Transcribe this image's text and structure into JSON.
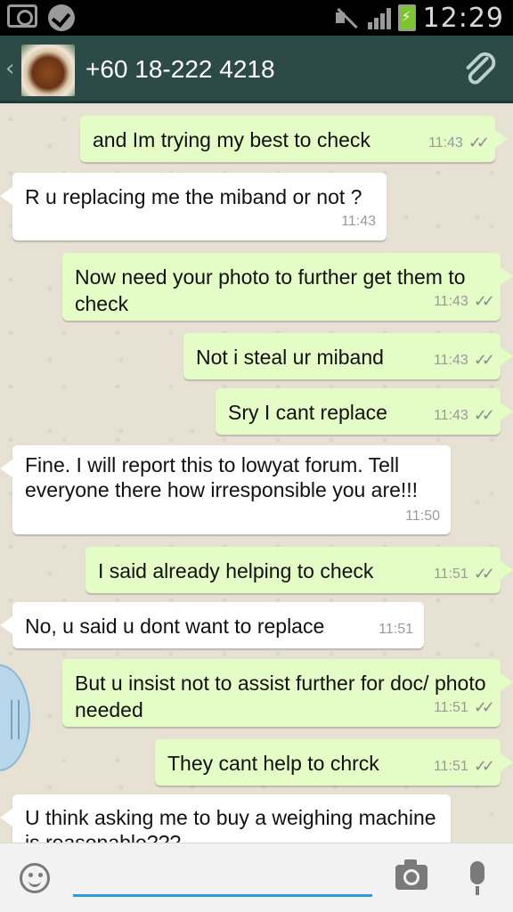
{
  "status_bar": {
    "time": "12:29",
    "icons": [
      "camera-icon",
      "check-badge-icon",
      "mute-icon",
      "signal-icon",
      "battery-charging-icon"
    ]
  },
  "header": {
    "back_icon": "chevron-left-icon",
    "contact_name": "+60 18-222 4218",
    "attach_icon": "paperclip-icon"
  },
  "messages": [
    {
      "direction": "out",
      "text": "and Im trying my best to check",
      "time": "11:43",
      "ticks": "✓✓"
    },
    {
      "direction": "in",
      "text": "R u replacing me the miband or not ?",
      "time": "11:43"
    },
    {
      "direction": "out",
      "text": "Now need your photo to further get them to check",
      "time": "11:43",
      "ticks": "✓✓"
    },
    {
      "direction": "out",
      "text": "Not i steal ur miband",
      "time": "11:43",
      "ticks": "✓✓"
    },
    {
      "direction": "out",
      "text": "Sry I cant replace",
      "time": "11:43",
      "ticks": "✓✓"
    },
    {
      "direction": "in",
      "text": "Fine. I will report this to lowyat forum. Tell everyone there how irresponsible you are!!!",
      "time": "11:50"
    },
    {
      "direction": "out",
      "text": "I said already helping to check",
      "time": "11:51",
      "ticks": "✓✓"
    },
    {
      "direction": "in",
      "text": "No, u said u dont want to replace",
      "time": "11:51"
    },
    {
      "direction": "out",
      "text": "But u insist not to assist further for doc/ photo needed",
      "time": "11:51",
      "ticks": "✓✓"
    },
    {
      "direction": "out",
      "text": "They cant help to chrck",
      "time": "11:51",
      "ticks": "✓✓"
    },
    {
      "direction": "in",
      "text": "U think asking me to buy a weighing machine is reasonable???",
      "time": ""
    }
  ],
  "input_bar": {
    "emoji_icon": "smiley-icon",
    "message_placeholder": "",
    "camera_icon": "camera-icon",
    "mic_icon": "microphone-icon"
  },
  "colors": {
    "header_bg": "#2c4a46",
    "outgoing_bubble": "#e4fcc6",
    "incoming_bubble": "#ffffff",
    "input_underline": "#2d9bd8"
  }
}
